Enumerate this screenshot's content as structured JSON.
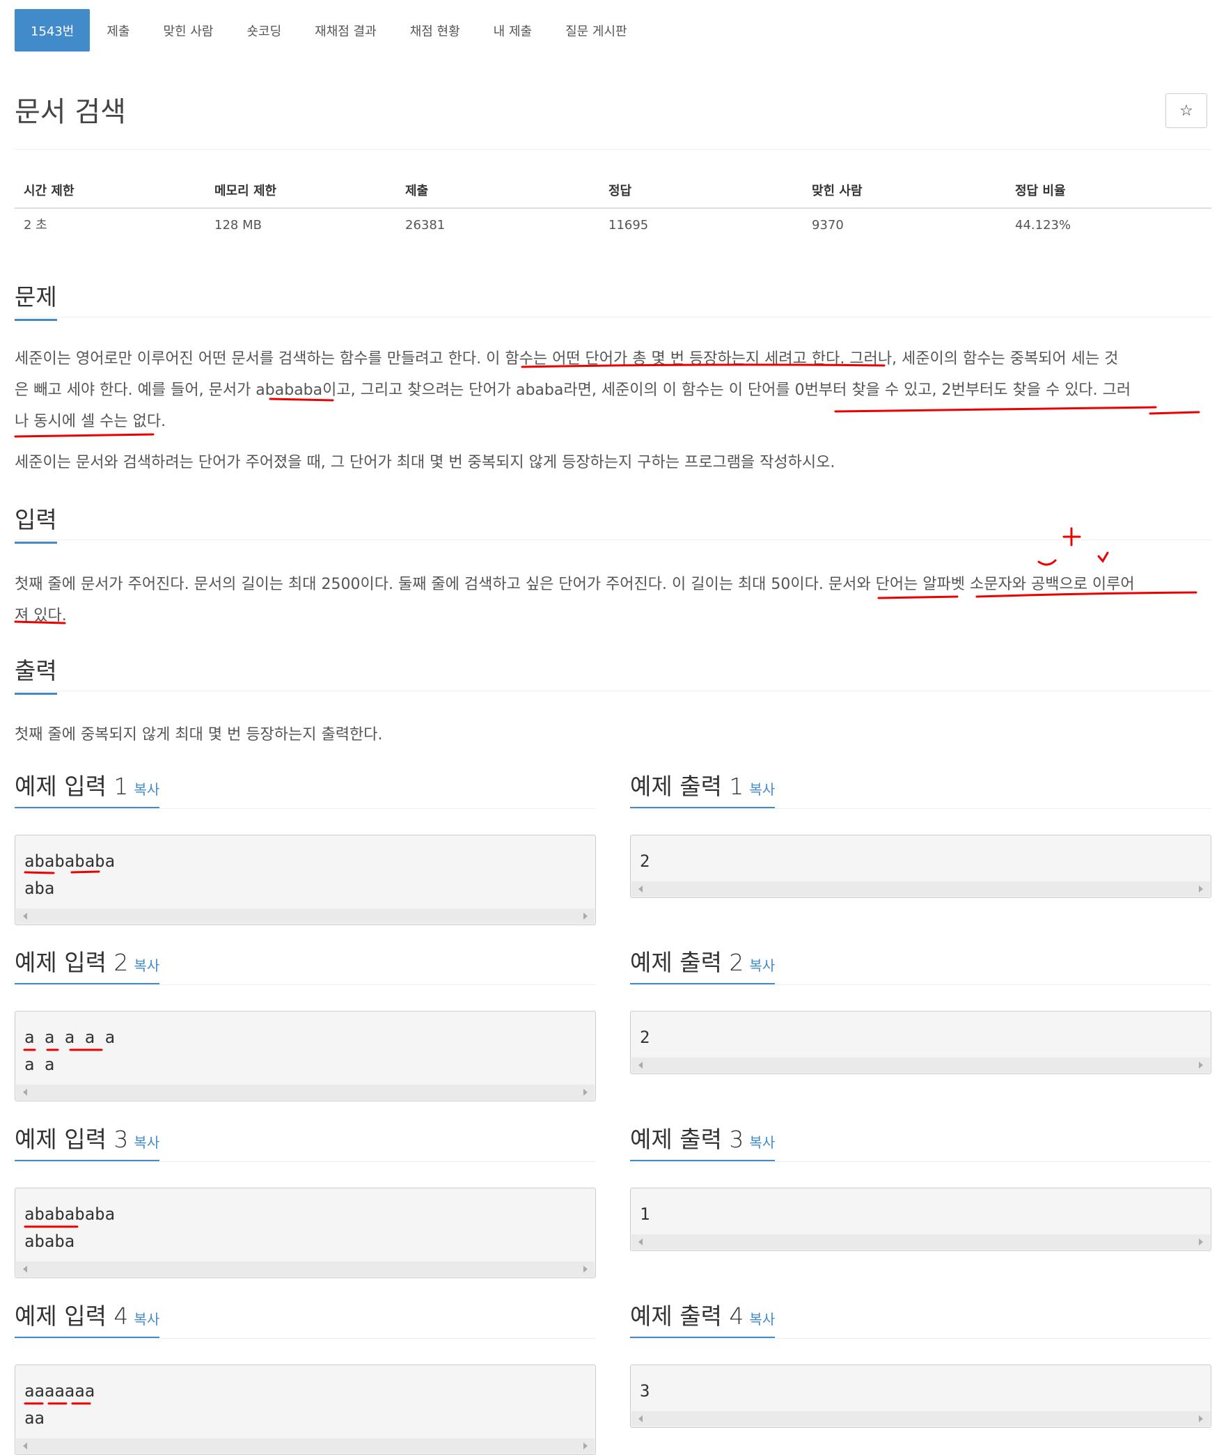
{
  "tabs": [
    "1543번",
    "제출",
    "맞힌 사람",
    "숏코딩",
    "재채점 결과",
    "채점 현황",
    "내 제출",
    "질문 게시판"
  ],
  "title": "문서 검색",
  "star_icon": "star-icon",
  "info": {
    "headers": [
      "시간 제한",
      "메모리 제한",
      "제출",
      "정답",
      "맞힌 사람",
      "정답 비율"
    ],
    "values": [
      "2 초",
      "128 MB",
      "26381",
      "11695",
      "9370",
      "44.123%"
    ]
  },
  "problem": {
    "heading": "문제",
    "p1_line1": "세준이는 영어로만 이루어진 어떤 문서를 검색하는 함수를 만들려고 한다. 이 함수는 어떤 단어가 총 몇 번 등장하는지 세려고 한다. 그러나, 세준이의 함수는 중복되어 세는 것",
    "p1_line2": "은 빼고 세야 한다. 예를 들어, 문서가 abababa이고, 그리고 찾으려는 단어가 ababa라면, 세준이의 이 함수는 이 단어를 0번부터 찾을 수 있고, 2번부터도 찾을 수 있다. 그러",
    "p1_line3": "나 동시에 셀 수는 없다.",
    "p2": "세준이는 문서와 검색하려는 단어가 주어졌을 때, 그 단어가 최대 몇 번 중복되지 않게 등장하는지 구하는 프로그램을 작성하시오."
  },
  "input": {
    "heading": "입력",
    "line1": "첫째 줄에 문서가 주어진다. 문서의 길이는 최대 2500이다. 둘째 줄에 검색하고 싶은 단어가 주어진다. 이 길이는 최대 50이다. 문서와 단어는 알파벳 소문자와 공백으로 이루어",
    "line2": "져 있다."
  },
  "output": {
    "heading": "출력",
    "text": "첫째 줄에 중복되지 않게 최대 몇 번 등장하는지 출력한다."
  },
  "copy_label": "복사",
  "samples": [
    {
      "in_title": "예제 입력 1",
      "out_title": "예제 출력 1",
      "input": "ababababa\naba",
      "output": "2"
    },
    {
      "in_title": "예제 입력 2",
      "out_title": "예제 출력 2",
      "input": "a a a a a\na a",
      "output": "2"
    },
    {
      "in_title": "예제 입력 3",
      "out_title": "예제 출력 3",
      "input": "ababababa\nababa",
      "output": "1"
    },
    {
      "in_title": "예제 입력 4",
      "out_title": "예제 출력 4",
      "input": "aaaaaaa\naa",
      "output": "3"
    }
  ]
}
